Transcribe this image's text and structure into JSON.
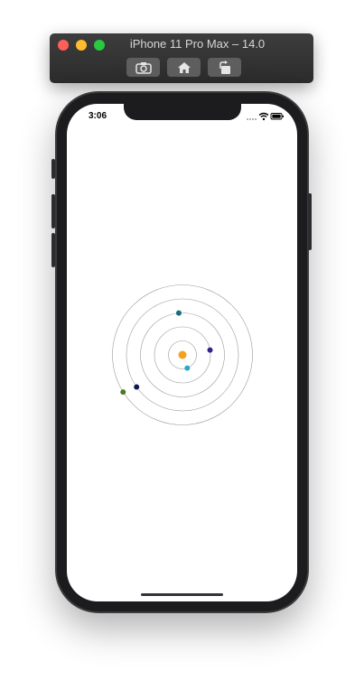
{
  "window": {
    "title": "iPhone 11 Pro Max – 14.0",
    "buttons": [
      {
        "name": "screenshot-button",
        "icon": "camera-icon"
      },
      {
        "name": "home-button",
        "icon": "home-icon"
      },
      {
        "name": "rotate-button",
        "icon": "rotate-icon"
      }
    ]
  },
  "status_bar": {
    "time": "3:06"
  },
  "orbit_view": {
    "sun_color": "#f5a020",
    "ring_color": "#9a9a9a",
    "planets": [
      {
        "name": "planet-1",
        "color": "#2aa7c8",
        "ring": 1,
        "angle_deg": 70
      },
      {
        "name": "planet-2",
        "color": "#31258c",
        "ring": 2,
        "angle_deg": -10
      },
      {
        "name": "planet-3",
        "color": "#166d7a",
        "ring": 3,
        "angle_deg": -95
      },
      {
        "name": "planet-4",
        "color": "#111550",
        "ring": 4,
        "angle_deg": 145
      },
      {
        "name": "planet-5",
        "color": "#4a7a22",
        "ring": 5,
        "angle_deg": 148
      }
    ]
  }
}
